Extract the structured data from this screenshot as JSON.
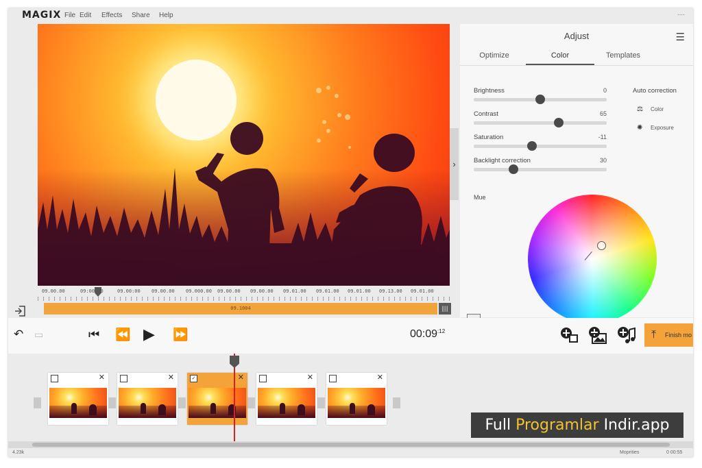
{
  "app": {
    "logo": "MAGIX",
    "menu": [
      "File",
      "Edit",
      "Effects",
      "Share",
      "Help"
    ],
    "window_dots": "...."
  },
  "preview": {
    "toggle_glyph": "›"
  },
  "ruler": {
    "labels": [
      "09.00.00",
      "09:00.00",
      "09.00:00",
      "09.00.00",
      "09.000.00",
      "09.00.00",
      "09.00.00",
      "09.01.00",
      "09.01.00",
      "09.01.00",
      "09.13.00",
      "09.01.00"
    ],
    "range_label": "09.1004"
  },
  "adjust": {
    "title": "Adjust",
    "tabs": [
      {
        "label": "Optimize",
        "active": false
      },
      {
        "label": "Color",
        "active": true
      },
      {
        "label": "Templates",
        "active": false
      }
    ],
    "sliders": [
      {
        "label": "Brightness",
        "value": "0",
        "level": 0.5
      },
      {
        "label": "Contrast",
        "value": "65",
        "level": 0.64
      },
      {
        "label": "Saturation",
        "value": "-11",
        "level": 0.44
      },
      {
        "label": "Backlight correction",
        "value": "30",
        "level": 0.3
      }
    ],
    "auto_correction": {
      "title": "Auto correction",
      "items": [
        {
          "label": "Color",
          "icon": "color-correction-icon"
        },
        {
          "label": "Exposure",
          "icon": "exposure-icon"
        }
      ]
    },
    "hue_label": "Mue"
  },
  "transport": {
    "timecode": "00:09",
    "timecode_frames": ":12",
    "finish_label": "Finish mo"
  },
  "storyboard": {
    "clips": [
      {
        "selected": false
      },
      {
        "selected": false
      },
      {
        "selected": true
      },
      {
        "selected": false
      },
      {
        "selected": false
      }
    ]
  },
  "statusbar": {
    "left": "4.23k",
    "middle": "Moprities",
    "right": "0 00:55"
  },
  "watermark": {
    "part1": "Full ",
    "part2": "Programlar",
    "part3": " Indir.app"
  },
  "colors": {
    "accent": "#f4a23a",
    "panel_bg": "#f7f7f7",
    "app_bg": "#ebebeb",
    "playhead": "#d42020"
  }
}
